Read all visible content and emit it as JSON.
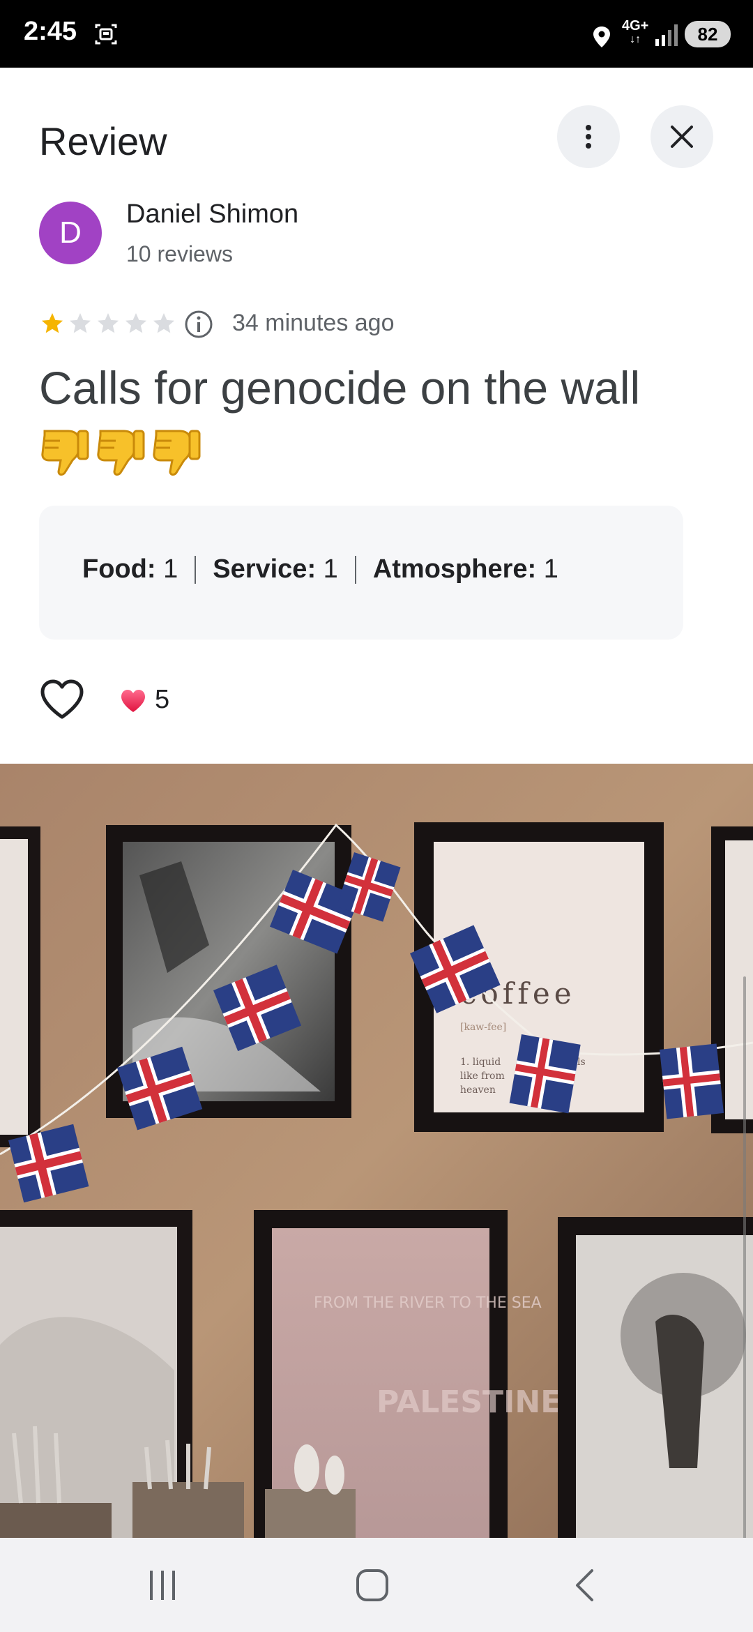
{
  "status_bar": {
    "time": "2:45",
    "network": "4G+",
    "battery": "82"
  },
  "header": {
    "title": "Review"
  },
  "reviewer": {
    "initial": "D",
    "avatar_color": "#a142c4",
    "name": "Daniel Shimon",
    "review_count": "10 reviews"
  },
  "review": {
    "rating": 1,
    "max_rating": 5,
    "time_ago": "34 minutes ago",
    "text": "Calls for genocide on the wall",
    "emoji_count": 3,
    "sub_ratings": [
      {
        "label": "Food:",
        "value": "1"
      },
      {
        "label": "Service:",
        "value": "1"
      },
      {
        "label": "Atmosphere:",
        "value": "1"
      }
    ]
  },
  "reactions": {
    "like_count": "5"
  },
  "photo": {
    "flag_colors": {
      "blue": "#2a3f86",
      "white": "#ffffff",
      "red": "#d2313b"
    },
    "poster_text": {
      "coffee": "coffee",
      "pronunciation": "[kaw-fee]",
      "definition_1": "1. liquid",
      "definition_2": "like from",
      "definition_3": "heaven",
      "definition_tail": "ls",
      "bottom_poster": "FROM THE RIVER TO THE SEA",
      "bottom_poster_2": "PALESTINE"
    }
  }
}
